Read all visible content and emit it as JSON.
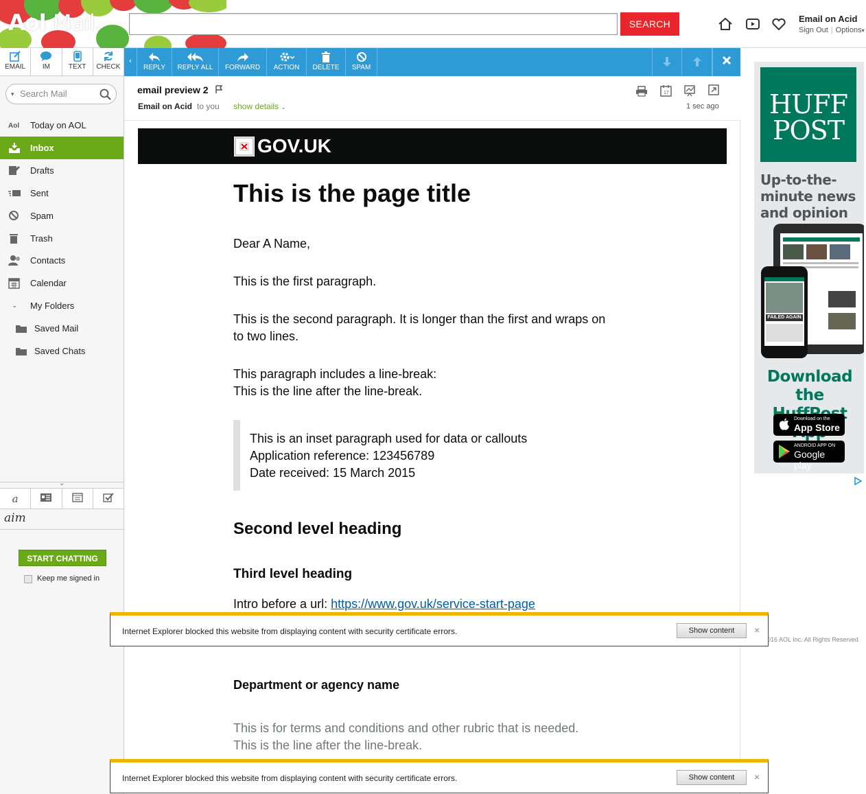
{
  "header": {
    "logo_aol": "Aol",
    "logo_mail": "Mail.",
    "search_button": "SEARCH",
    "account_name": "Email on Acid",
    "sign_out": "Sign Out",
    "options": "Options"
  },
  "compose_buttons": [
    "EMAIL",
    "IM",
    "TEXT",
    "CHECK"
  ],
  "toolbar": {
    "reply": "REPLY",
    "reply_all": "REPLY ALL",
    "forward": "FORWARD",
    "action": "ACTION",
    "delete": "DELETE",
    "spam": "SPAM"
  },
  "sidebar": {
    "search_placeholder": "Search Mail",
    "items": [
      "Today on AOL",
      "Inbox",
      "Drafts",
      "Sent",
      "Spam",
      "Trash",
      "Contacts",
      "Calendar",
      "My Folders",
      "Saved Mail",
      "Saved Chats"
    ],
    "aim_label": "aim",
    "start_chatting": "START CHATTING",
    "keep_signed_in": "Keep me signed in"
  },
  "message": {
    "subject": "email preview 2",
    "sender": "Email on Acid",
    "to": "to you",
    "show_details": "show details",
    "time": "1 sec ago",
    "gov_logo_text": "GOV.UK",
    "title": "This is the page title",
    "greeting": "Dear A Name,",
    "para1": "This is the first paragraph.",
    "para2_line1": "This is the second paragraph. It is longer than the first and wraps on",
    "para2_line2": "to two lines.",
    "para3_line1": "This paragraph includes a line-break:",
    "para3_line2": "This is the line after the line-break.",
    "inset_line1": "This is an inset paragraph used for data or callouts",
    "inset_line2": "Application reference: 123456789",
    "inset_line3": "Date received: 15 March 2015",
    "heading2": "Second level heading",
    "heading3": "Third level heading",
    "url_intro": "Intro before a url:",
    "url": "https://www.gov.uk/service-start-page",
    "dept_name": "Department or agency name",
    "rubric_line1": "This is for terms and conditions and other rubric that is needed.",
    "rubric_line2": "This is the line after the line-break."
  },
  "ad": {
    "brand_line1": "HUFF",
    "brand_line2": "POST",
    "tagline": "Up-to-the-minute news and opinion",
    "phone_label": "FAILED AGAIN",
    "download_line1": "Download the",
    "download_line2": "HuffPost App",
    "appstore_small": "Download on the",
    "appstore_big": "App Store",
    "play_small": "ANDROID APP ON",
    "play_big": "Google play",
    "copyright": "016 AOL Inc. All Rights Reserved"
  },
  "ie_notice": {
    "message": "Internet Explorer blocked this website from displaying content with security certificate errors.",
    "button": "Show content",
    "close": "×"
  }
}
